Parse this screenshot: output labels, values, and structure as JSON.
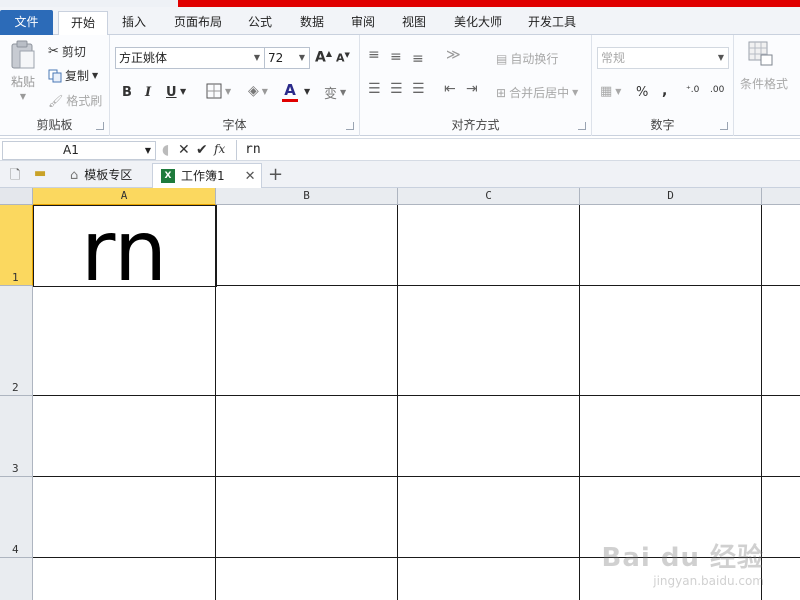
{
  "ribbon_tabs": [
    {
      "label": "文件",
      "active": false,
      "file": true
    },
    {
      "label": "开始",
      "active": true
    },
    {
      "label": "插入",
      "active": false
    },
    {
      "label": "页面布局",
      "active": false
    },
    {
      "label": "公式",
      "active": false
    },
    {
      "label": "数据",
      "active": false
    },
    {
      "label": "审阅",
      "active": false
    },
    {
      "label": "视图",
      "active": false
    },
    {
      "label": "美化大师",
      "active": false
    },
    {
      "label": "开发工具",
      "active": false
    }
  ],
  "clipboard": {
    "group_label": "剪贴板",
    "paste": "粘贴",
    "cut": "剪切",
    "copy": "复制",
    "format_painter": "格式刷"
  },
  "font": {
    "group_label": "字体",
    "font_name": "方正姚体",
    "font_size": "72",
    "bold": "B",
    "italic": "I",
    "underline": "U",
    "font_color_letter": "A",
    "phonetic": "变"
  },
  "alignment": {
    "group_label": "对齐方式",
    "wrap_text": "自动换行",
    "merge_center": "合并后居中"
  },
  "number": {
    "group_label": "数字",
    "format": "常规",
    "percent": "%",
    "comma": ",",
    "increase_decimal": "+.0\n.00",
    "decrease_decimal": ".00\n→.0"
  },
  "styles": {
    "conditional_formatting": "条件格式"
  },
  "formula_bar": {
    "name_box": "A1",
    "content": "rn"
  },
  "doc_tabs": [
    {
      "label": "模板专区"
    },
    {
      "label": "工作簿1"
    }
  ],
  "grid": {
    "columns": [
      "A",
      "B",
      "C",
      "D"
    ],
    "rows": [
      "1",
      "2",
      "3",
      "4"
    ],
    "selected_cell": "A1",
    "a1_value": "rn"
  },
  "watermark": {
    "line1": "Bai du 经验",
    "line2": "jingyan.baidu.com"
  },
  "colors": {
    "file_tab": "#2c6bb8",
    "selection_header": "#fbd85f",
    "font_color_bar": "#e00000",
    "top_strip": "#e00000"
  }
}
